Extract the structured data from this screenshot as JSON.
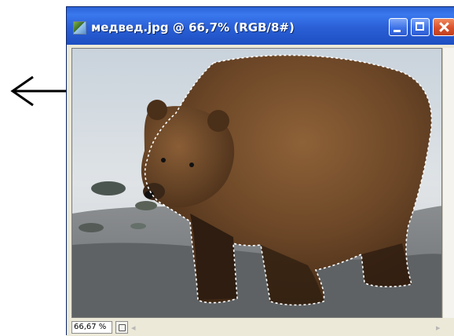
{
  "annotation": {
    "arrow_direction": "left",
    "arrow_color": "#000000"
  },
  "window": {
    "title": "медвед.jpg @ 66,7% (RGB/8#)",
    "title_bar_color": "#2a5fd6",
    "buttons": [
      "minimize-icon",
      "maximize-icon",
      "close-icon"
    ]
  },
  "image": {
    "subject": "brown bear with marching-ants selection outline",
    "selection_style": "dashed"
  },
  "status_bar": {
    "zoom": "66,67 %"
  }
}
